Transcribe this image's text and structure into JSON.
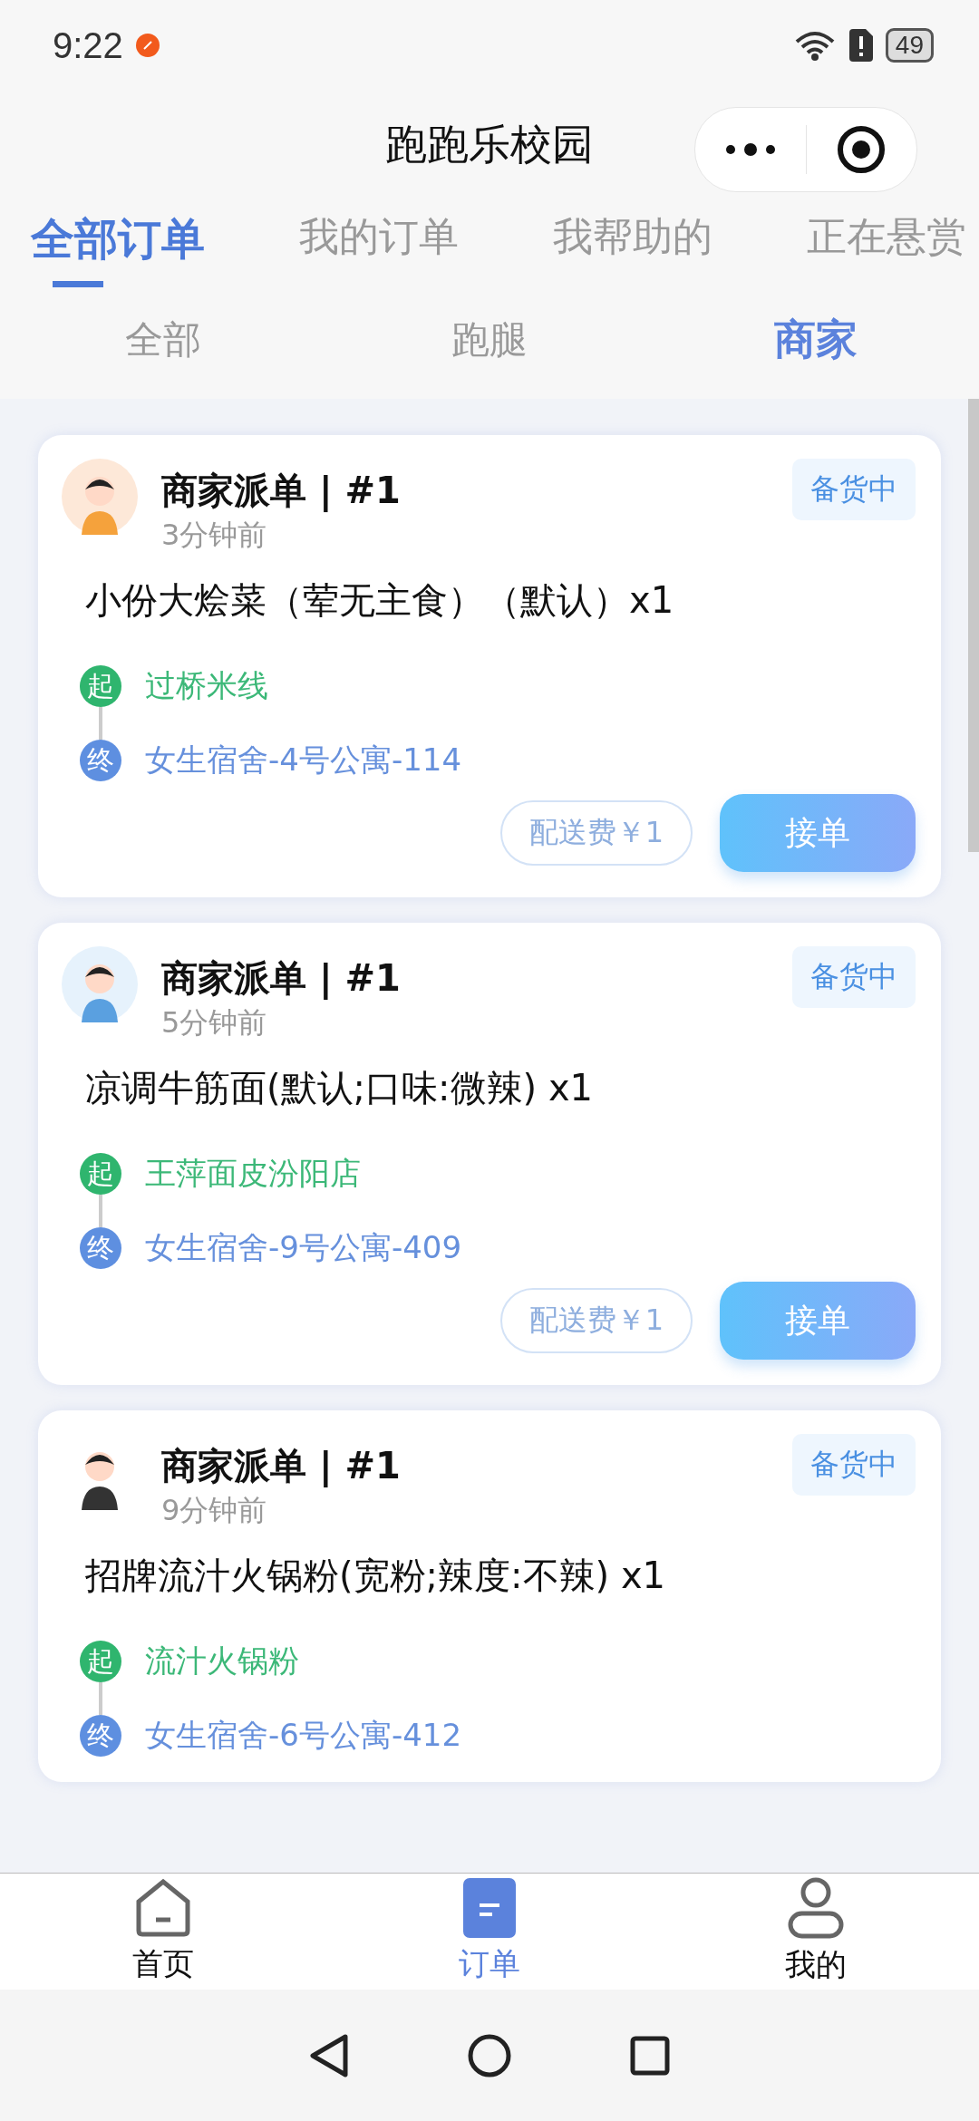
{
  "status_bar": {
    "time": "9:22",
    "battery": "49"
  },
  "header": {
    "title": "跑跑乐校园"
  },
  "tabs": [
    {
      "label": "全部订单",
      "selected": true
    },
    {
      "label": "我的订单",
      "selected": false
    },
    {
      "label": "我帮助的",
      "selected": false
    },
    {
      "label": "正在悬赏",
      "selected": false
    }
  ],
  "subtabs": [
    {
      "label": "全部",
      "selected": false
    },
    {
      "label": "跑腿",
      "selected": false
    },
    {
      "label": "商家",
      "selected": true
    }
  ],
  "orders": [
    {
      "title": "商家派单 | #1",
      "time": "3分钟前",
      "status": "备货中",
      "item": "小份大烩菜（荤无主食）（默认）x1",
      "origin_badge": "起",
      "origin": "过桥米线",
      "dest_badge": "终",
      "destination": "女生宿舍-4号公寓-114",
      "fee": "配送费￥1",
      "action": "接单"
    },
    {
      "title": "商家派单 | #1",
      "time": "5分钟前",
      "status": "备货中",
      "item": "凉调牛筋面(默认;口味:微辣) x1",
      "origin_badge": "起",
      "origin": "王萍面皮汾阳店",
      "dest_badge": "终",
      "destination": "女生宿舍-9号公寓-409",
      "fee": "配送费￥1",
      "action": "接单"
    },
    {
      "title": "商家派单 | #1",
      "time": "9分钟前",
      "status": "备货中",
      "item": "招牌流汁火锅粉(宽粉;辣度:不辣) x1",
      "origin_badge": "起",
      "origin": "流汁火锅粉",
      "dest_badge": "终",
      "destination": "女生宿舍-6号公寓-412"
    }
  ],
  "bottom_nav": [
    {
      "kind": "home",
      "label": "首页",
      "selected": false
    },
    {
      "kind": "orders",
      "label": "订单",
      "selected": true
    },
    {
      "kind": "profile",
      "label": "我的",
      "selected": false
    }
  ]
}
